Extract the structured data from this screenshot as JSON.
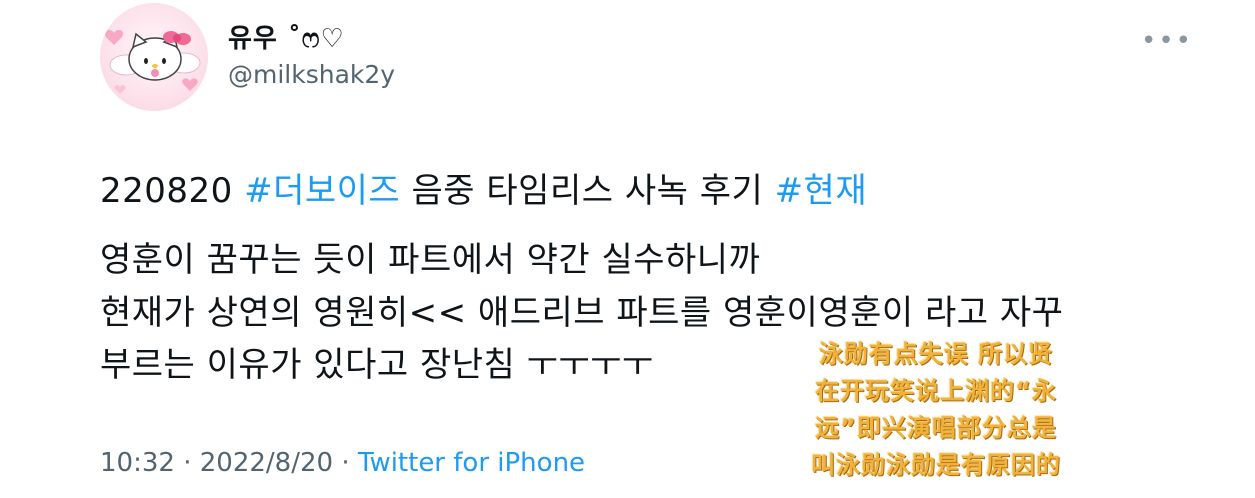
{
  "user": {
    "display_name": "유우 ˚ෆ♡",
    "handle": "@milkshak2y"
  },
  "more_icon": "more-dots-icon",
  "avatar_icon": "hello-kitty-avatar",
  "tweet": {
    "line1": {
      "prefix": "220820 ",
      "hashtag1": "#더보이즈",
      "middle": " 음중 타임리스 사녹 후기 ",
      "hashtag2": "#현재"
    },
    "line2": "영훈이 꿈꾸는 듯이 파트에서 약간 실수하니까",
    "line3": "현재가 상연의 영원히<< 애드리브 파트를 영훈이영훈이 라고 자꾸",
    "line4": "부르는 이유가 있다고 장난침 ㅜㅜㅜㅜ"
  },
  "meta": {
    "time": "10:32",
    "sep1": " · ",
    "date": "2022/8/20",
    "sep2": " · ",
    "source": "Twitter for iPhone"
  },
  "caption": {
    "line1": "泳勋有点失误  所以贤",
    "line2": "在开玩笑说上渊的“永",
    "line3": "远”即兴演唱部分总是",
    "line4": "叫泳勋泳勋是有原因的"
  },
  "colors": {
    "link": "#1d9bf0",
    "muted": "#536471",
    "caption": "#f0b23a"
  }
}
